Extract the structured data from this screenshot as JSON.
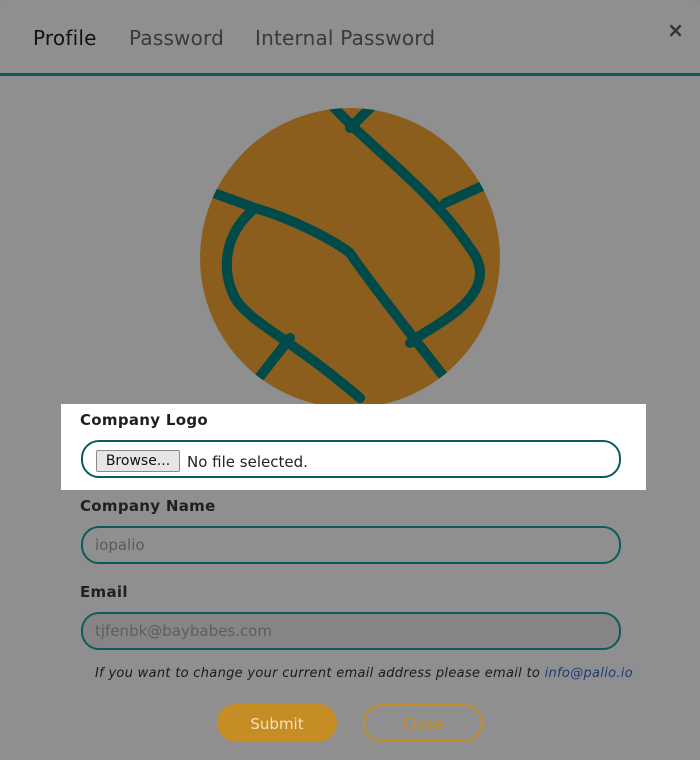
{
  "tabs": [
    {
      "label": "Profile"
    },
    {
      "label": "Password"
    },
    {
      "label": "Internal Password"
    }
  ],
  "close_symbol": "×",
  "logo": {
    "icon": "ball-logo",
    "colors": {
      "fill": "#8b5e1e",
      "stroke": "#004a4a"
    }
  },
  "form": {
    "company_logo_label": "Company Logo",
    "browse_label": "Browse...",
    "file_status": "No file selected.",
    "company_name_label": "Company Name",
    "company_name_value": "iopalio",
    "email_label": "Email",
    "email_value": "tjfenbk@baybabes.com",
    "hint_text": "If you want to change your current email address please email to ",
    "hint_email": "info@palio.io"
  },
  "buttons": {
    "submit": "Submit",
    "close": "Close"
  },
  "colors": {
    "accent": "#c68d25",
    "teal": "#0b5a5a"
  }
}
